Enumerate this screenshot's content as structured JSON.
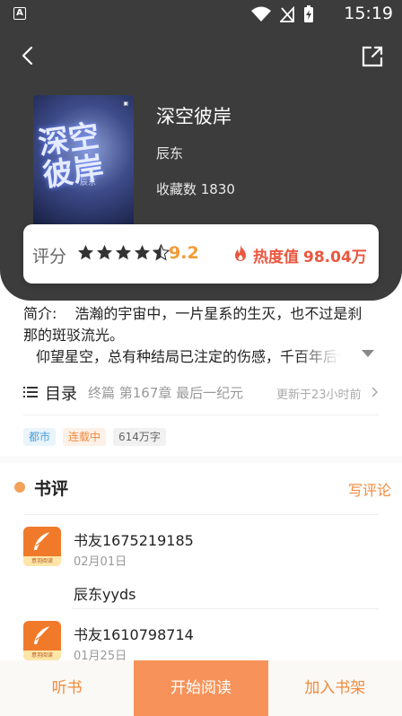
{
  "status_bar": {
    "time": "15:19",
    "left_icon_letter": "A"
  },
  "nav": {
    "back_icon": "chevron-left-icon",
    "share_icon": "share-external-icon"
  },
  "book": {
    "cover_title": "深空彼岸",
    "cover_author": "辰东",
    "title": "深空彼岸",
    "author": "辰东",
    "favorites": "收藏数 1830"
  },
  "rating": {
    "label": "评分",
    "stars": 4.5,
    "score": "9.2",
    "heat_label": "热度值",
    "heat_value": "98.04万",
    "star_color": "#333333",
    "score_color": "#f29b38",
    "heat_color": "#e9573f"
  },
  "intro": {
    "label": "简介:",
    "line1": "浩瀚的宇宙中，一片星系的生灭，也不过是刹那的斑驳流光。",
    "line2": "仰望星空，总有种结局已注定的伤感，千百年后你"
  },
  "catalog": {
    "label": "目录",
    "latest": "终篇 第167章 最后一纪元",
    "updated": "更新于23小时前"
  },
  "tags": [
    "都市",
    "连载中",
    "614万字"
  ],
  "reviews": {
    "title": "书评",
    "write_label": "写评论",
    "items": [
      {
        "user": "书友1675219185",
        "date": "02月01日",
        "content": "辰东yyds",
        "avatar_text": "意羽阅读"
      },
      {
        "user": "书友1610798714",
        "date": "01月25日",
        "content": "",
        "avatar_text": "意羽阅读"
      }
    ]
  },
  "bottom_bar": {
    "listen": "听书",
    "read": "开始阅读",
    "add_shelf": "加入书架",
    "accent": "#f7935a"
  }
}
